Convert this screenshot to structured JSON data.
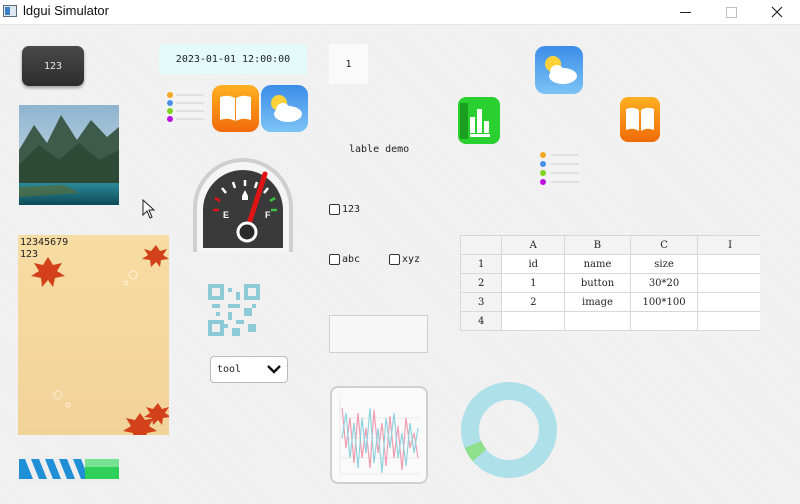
{
  "window": {
    "title": "ldgui Simulator"
  },
  "widgets": {
    "button_label": "123",
    "datetime": "2023-01-01 12:00:00",
    "spinbox_value": "1",
    "label_demo": "lable demo",
    "poster_text_line1": "12345679",
    "poster_text_line2": "123",
    "checkbox_1": "123",
    "checkbox_abc": "abc",
    "checkbox_xyz": "xyz",
    "dropdown_value": "tool",
    "gauge_left_label": "E",
    "gauge_right_label": "F",
    "progress_fraction": 0.3,
    "ring_fraction": 0.12
  },
  "table": {
    "columns": [
      "",
      "A",
      "B",
      "C",
      "I"
    ],
    "rows": [
      [
        "1",
        "id",
        "name",
        "size",
        ""
      ],
      [
        "2",
        "1",
        "button",
        "30*20",
        ""
      ],
      [
        "3",
        "2",
        "image",
        "100*100",
        ""
      ],
      [
        "4",
        "",
        "",
        "",
        ""
      ]
    ]
  },
  "colors": {
    "datetime_bg": "#e3fbfb",
    "ring_main": "#aee0ea",
    "ring_accent": "#8fe08a",
    "progress_stripe": "#1f8fd6",
    "progress_fill": "#2fd05a",
    "gauge_needle": "#e01414"
  },
  "icons": {
    "notes_app": "notes-list-icon",
    "books_app": "books-icon",
    "weather_app": "weather-icon",
    "numbers_app": "bar-chart-icon"
  }
}
